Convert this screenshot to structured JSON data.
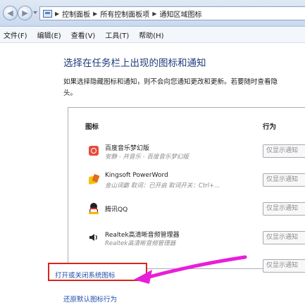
{
  "address_bar": {
    "breadcrumbs": [
      "控制面板",
      "所有控制面板项",
      "通知区域图标"
    ]
  },
  "menu": {
    "items": [
      "文件(F)",
      "编辑(E)",
      "查看(V)",
      "工具(T)",
      "帮助(H)"
    ]
  },
  "page": {
    "title": "选择在任务栏上出现的图标和通知",
    "description_line1": "如果选择隐藏图标和通知，则不会向您通知更改和更新。若要随时查看隐",
    "description_line2": "头。"
  },
  "table": {
    "col_icon": "图标",
    "col_behavior": "行为",
    "rows": [
      {
        "name": "百度音乐梦幻版",
        "sub": "安静 - 共音乐 - 百度音乐梦幻版",
        "behavior": "仅显示通知",
        "icon": "baidu-music-icon"
      },
      {
        "name": "Kingsoft PowerWord",
        "sub": "金山词霸 取词：已开启 取词开关：Ctrl+...",
        "behavior": "仅显示通知",
        "icon": "kingsoft-powerword-icon"
      },
      {
        "name": "腾讯QQ",
        "sub": "",
        "behavior": "仅显示通知",
        "icon": "qq-penguin-icon"
      },
      {
        "name": "Realtek高清晰音频管理器",
        "sub": "Realtek高清晰音频管理器",
        "behavior": "仅显示通知",
        "icon": "realtek-speaker-icon"
      },
      {
        "name": "",
        "sub": "",
        "behavior": "仅显示通知",
        "icon": ""
      }
    ]
  },
  "links": {
    "system_icons": "打开或关闭系统图标",
    "restore": "还原默认图标行为"
  },
  "colors": {
    "title_blue": "#1f3d7a",
    "link_blue": "#1f4fa8",
    "highlight_red": "#d9261c",
    "annotation_magenta": "#e81fd8"
  }
}
